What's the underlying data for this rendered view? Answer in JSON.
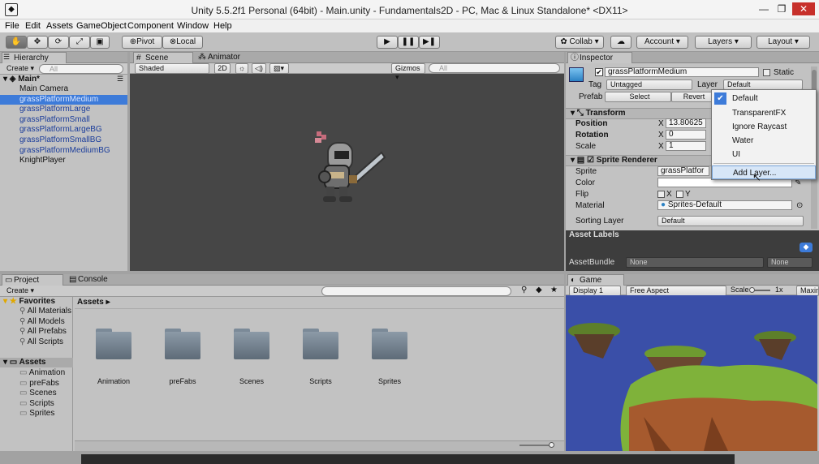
{
  "window": {
    "title": "Unity 5.5.2f1 Personal (64bit) - Main.unity - Fundamentals2D - PC, Mac & Linux Standalone* <DX11>",
    "app_icon": "unity-icon"
  },
  "menu": [
    "File",
    "Edit",
    "Assets",
    "GameObject",
    "Component",
    "Window",
    "Help"
  ],
  "toolbar": {
    "pivot": "Pivot",
    "local": "Local",
    "collab": "Collab ▾",
    "account": "Account",
    "layers": "Layers",
    "layout": "Layout"
  },
  "hierarchy": {
    "tab": "Hierarchy",
    "create": "Create ▾",
    "search": "All",
    "scene": "Main*",
    "items": [
      {
        "label": "Main Camera",
        "style": "normal"
      },
      {
        "label": "grassPlatformMedium",
        "style": "selected"
      },
      {
        "label": "grassPlatformLarge",
        "style": "prefab"
      },
      {
        "label": "grassPlatformSmall",
        "style": "prefab"
      },
      {
        "label": "grassPlatformLargeBG",
        "style": "prefab"
      },
      {
        "label": "grassPlatformSmallBG",
        "style": "prefab"
      },
      {
        "label": "grassPlatformMediumBG",
        "style": "prefab"
      },
      {
        "label": "KnightPlayer",
        "style": "normal"
      }
    ]
  },
  "scene": {
    "tab_scene": "Scene",
    "tab_animator": "Animator",
    "shaded": "Shaded",
    "mode2d": "2D",
    "gizmos": "Gizmos ▾",
    "search": "All"
  },
  "inspector": {
    "tab": "Inspector",
    "name": "grassPlatformMedium",
    "static": "Static",
    "tag_label": "Tag",
    "tag": "Untagged",
    "layer_label": "Layer",
    "layer": "Default",
    "prefab_label": "Prefab",
    "select": "Select",
    "revert": "Revert",
    "transform": "Transform",
    "position_label": "Position",
    "position_x": "13.80625",
    "rotation_label": "Rotation",
    "rotation_x": "0",
    "scale_label": "Scale",
    "scale_x": "1",
    "axis_x": "X",
    "sprite_renderer": "Sprite Renderer",
    "sprite_label": "Sprite",
    "sprite": "grassPlatfor",
    "color_label": "Color",
    "flip_label": "Flip",
    "flip_x": "X",
    "flip_y": "Y",
    "material_label": "Material",
    "material": "Sprites-Default",
    "sorting_label": "Sorting Layer",
    "sorting": "Default"
  },
  "layer_dropdown": {
    "items": [
      "Default",
      "TransparentFX",
      "Ignore Raycast",
      "Water",
      "UI",
      "Add Layer..."
    ],
    "checked": 0,
    "highlighted": 5
  },
  "asset_labels": {
    "title": "Asset Labels",
    "bundle_label": "AssetBundle",
    "bundle": "None",
    "variant": "None"
  },
  "project": {
    "tab_project": "Project",
    "tab_console": "Console",
    "create": "Create ▾",
    "favorites": "Favorites",
    "fav_items": [
      "All Materials",
      "All Models",
      "All Prefabs",
      "All Scripts"
    ],
    "assets": "Assets",
    "asset_items": [
      "Animation",
      "preFabs",
      "Scenes",
      "Scripts",
      "Sprites"
    ],
    "breadcrumb": "Assets ▸",
    "folders": [
      "Animation",
      "preFabs",
      "Scenes",
      "Scripts",
      "Sprites"
    ]
  },
  "game": {
    "tab": "Game",
    "display": "Display 1",
    "aspect": "Free Aspect",
    "scale_label": "Scale",
    "scale_value": "1x",
    "maximize": "Maximize"
  },
  "colors": {
    "selection": "#3d7bd9",
    "prefab_text": "#1b3d9b",
    "game_sky": "#3a4fa8",
    "grass": "#7fb23a"
  }
}
